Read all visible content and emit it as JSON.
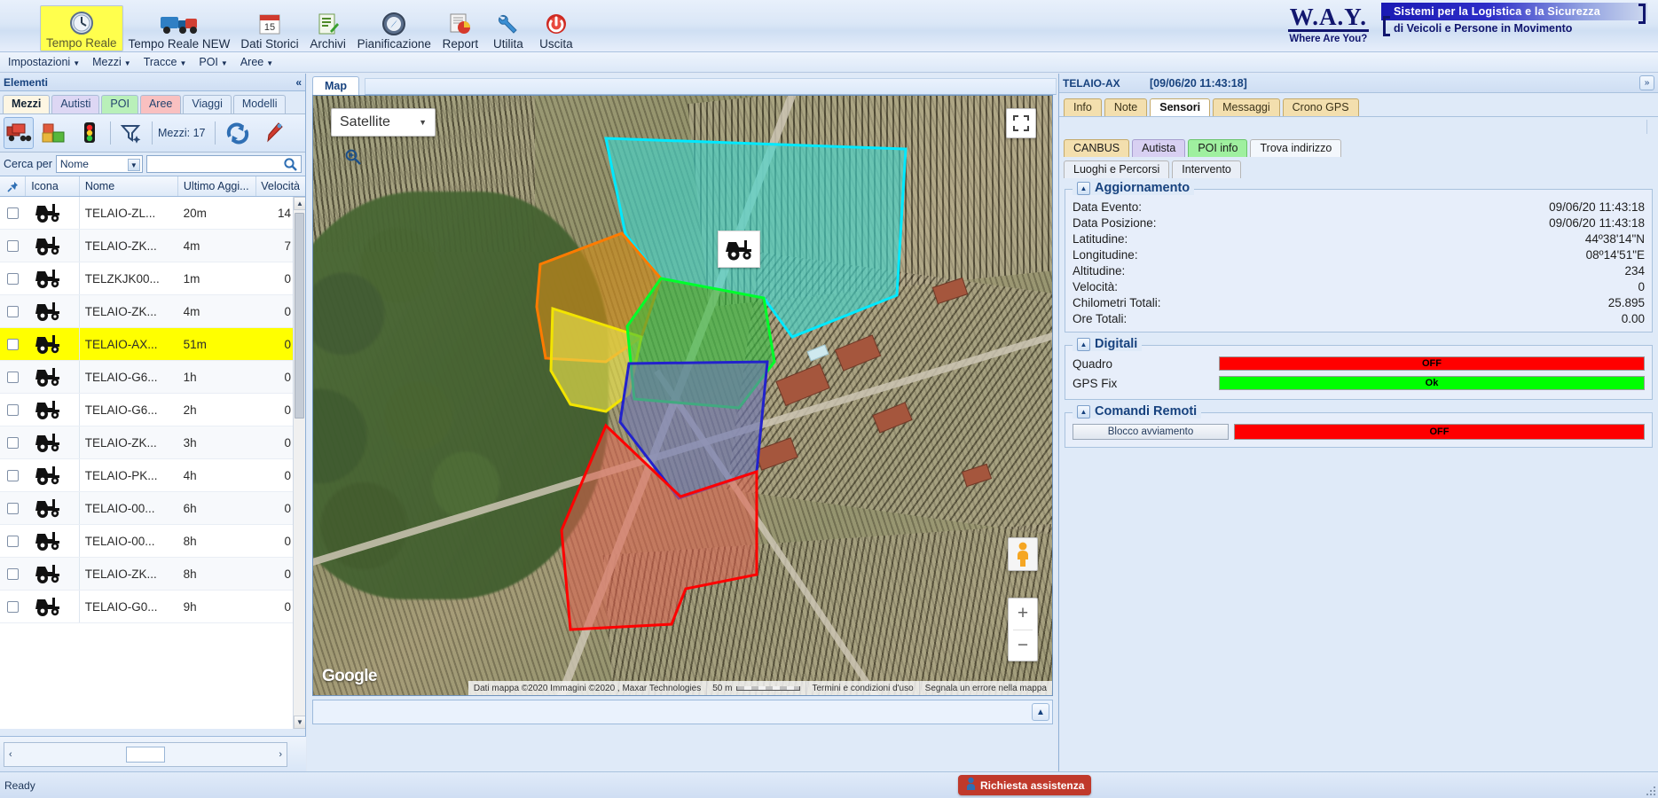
{
  "ribbon": {
    "items": [
      {
        "label": "Tempo Reale",
        "icon": "clock-icon",
        "active": true
      },
      {
        "label": "Tempo Reale NEW",
        "icon": "truck-icon",
        "active": false
      },
      {
        "label": "Dati Storici",
        "icon": "calendar-icon",
        "active": false
      },
      {
        "label": "Archivi",
        "icon": "document-edit-icon",
        "active": false
      },
      {
        "label": "Pianificazione",
        "icon": "compass-icon",
        "active": false
      },
      {
        "label": "Report",
        "icon": "report-chart-icon",
        "active": false
      },
      {
        "label": "Utilita",
        "icon": "wrench-icon",
        "active": false
      },
      {
        "label": "Uscita",
        "icon": "power-icon",
        "active": false
      }
    ],
    "logo": {
      "name": "W.A.Y.",
      "sub": "Where Are You?",
      "tagline_1": "Sistemi per la Logistica e la Sicurezza",
      "tagline_2": "di Veicoli e Persone in Movimento"
    }
  },
  "menubar": {
    "items": [
      "Impostazioni",
      "Mezzi",
      "Tracce",
      "POI",
      "Aree"
    ]
  },
  "left_panel": {
    "title": "Elementi",
    "collapse_icon": "chevron-double-left-icon",
    "tabs": [
      {
        "label": "Mezzi",
        "variant": "sel"
      },
      {
        "label": "Autisti",
        "variant": "v-autisti"
      },
      {
        "label": "POI",
        "variant": "v-poi"
      },
      {
        "label": "Aree",
        "variant": "v-aree"
      },
      {
        "label": "Viaggi",
        "variant": "v-plain"
      },
      {
        "label": "Modelli",
        "variant": "v-plain"
      }
    ],
    "toolbar": {
      "icons": [
        "fleet-icon",
        "packages-icon",
        "traffic-light-icon",
        "filter-icon",
        "refresh-icon",
        "marker-pin-icon"
      ],
      "count_label": "Mezzi: 17"
    },
    "search": {
      "label": "Cerca per",
      "select_value": "Nome",
      "input_value": "",
      "input_placeholder": "",
      "search_icon": "search-icon"
    },
    "grid": {
      "columns": [
        "",
        "Icona",
        "Nome",
        "Ultimo Aggi...",
        "Velocità"
      ],
      "rows": [
        {
          "name": "TELAIO-ZL...",
          "last": "20m",
          "speed": "14",
          "selected": false
        },
        {
          "name": "TELAIO-ZK...",
          "last": "4m",
          "speed": "7",
          "selected": false
        },
        {
          "name": "TELZKJK00...",
          "last": "1m",
          "speed": "0",
          "selected": false
        },
        {
          "name": "TELAIO-ZK...",
          "last": "4m",
          "speed": "0",
          "selected": false
        },
        {
          "name": "TELAIO-AX...",
          "last": "51m",
          "speed": "0",
          "selected": true
        },
        {
          "name": "TELAIO-G6...",
          "last": "1h",
          "speed": "0",
          "selected": false
        },
        {
          "name": "TELAIO-G6...",
          "last": "2h",
          "speed": "0",
          "selected": false
        },
        {
          "name": "TELAIO-ZK...",
          "last": "3h",
          "speed": "0",
          "selected": false
        },
        {
          "name": "TELAIO-PK...",
          "last": "4h",
          "speed": "0",
          "selected": false
        },
        {
          "name": "TELAIO-00...",
          "last": "6h",
          "speed": "0",
          "selected": false
        },
        {
          "name": "TELAIO-00...",
          "last": "8h",
          "speed": "0",
          "selected": false
        },
        {
          "name": "TELAIO-ZK...",
          "last": "8h",
          "speed": "0",
          "selected": false
        },
        {
          "name": "TELAIO-G0...",
          "last": "9h",
          "speed": "0",
          "selected": false
        }
      ]
    }
  },
  "map_panel": {
    "tab_label": "Map",
    "map_type": "Satellite",
    "map_type_caret": "chevron-down-icon",
    "controls": {
      "fullscreen_icon": "fullscreen-icon",
      "zoom_search_icon": "zoom-search-icon",
      "pegman_icon": "street-view-pegman-icon",
      "zoom_in": "+",
      "zoom_out": "−"
    },
    "watermark": "Google",
    "attribution": {
      "data": "Dati mappa ©2020 Immagini ©2020 , Maxar Technologies",
      "scale": "50 m",
      "terms": "Termini e condizioni d'uso",
      "report": "Segnala un errore nella mappa"
    },
    "vehicle_marker_icon": "tractor-icon",
    "zones": [
      {
        "name": "zone-cyan",
        "fill": "#3fd6cf",
        "stroke": "#00e5ff"
      },
      {
        "name": "zone-orange",
        "fill": "#d08a16",
        "stroke": "#ff7b00"
      },
      {
        "name": "zone-yellow",
        "fill": "#e8e04a",
        "stroke": "#f2e400"
      },
      {
        "name": "zone-green",
        "fill": "#2fbf3f",
        "stroke": "#00ff2a"
      },
      {
        "name": "zone-blue",
        "fill": "#6a74b5",
        "stroke": "#2222cc"
      },
      {
        "name": "zone-red",
        "fill": "#e0604f",
        "stroke": "#ff0000"
      }
    ]
  },
  "right_panel": {
    "vehicle": "TELAIO-AX",
    "datetime": "[09/06/20 11:43:18]",
    "expand_icon": "chevron-double-right-icon",
    "tabs": [
      {
        "label": "Info",
        "sel": false
      },
      {
        "label": "Note",
        "sel": false
      },
      {
        "label": "Sensori",
        "sel": true
      },
      {
        "label": "Messaggi",
        "sel": false
      },
      {
        "label": "Crono GPS",
        "sel": false
      }
    ],
    "tabs2": [
      {
        "label": "CANBUS",
        "variant": "canbus"
      },
      {
        "label": "Autista",
        "variant": "autista"
      },
      {
        "label": "POI info",
        "variant": "poiinfo"
      },
      {
        "label": "Trova indirizzo",
        "variant": "sel"
      }
    ],
    "tabs3": [
      {
        "label": "Luoghi e Percorsi"
      },
      {
        "label": "Intervento"
      }
    ],
    "aggiornamento": {
      "legend": "Aggiornamento",
      "toggle_icon": "collapse-up-icon",
      "fields": [
        {
          "key": "Data Evento:",
          "value": "09/06/20 11:43:18"
        },
        {
          "key": "Data Posizione:",
          "value": "09/06/20 11:43:18"
        },
        {
          "key": "Latitudine:",
          "value": "44º38'14\"N"
        },
        {
          "key": "Longitudine:",
          "value": "08º14'51\"E"
        },
        {
          "key": "Altitudine:",
          "value": "234"
        },
        {
          "key": "Velocità:",
          "value": "0"
        },
        {
          "key": "Chilometri Totali:",
          "value": "25.895"
        },
        {
          "key": "Ore Totali:",
          "value": "0.00"
        }
      ]
    },
    "digitali": {
      "legend": "Digitali",
      "toggle_icon": "collapse-up-icon",
      "rows": [
        {
          "key": "Quadro",
          "value": "OFF",
          "state": "red"
        },
        {
          "key": "GPS Fix",
          "value": "Ok",
          "state": "green"
        }
      ]
    },
    "comandi": {
      "legend": "Comandi Remoti",
      "toggle_icon": "collapse-up-icon",
      "rows": [
        {
          "button": "Blocco avviamento",
          "value": "OFF",
          "state": "red"
        }
      ]
    }
  },
  "statusbar": {
    "ready": "Ready",
    "assist_label": "Richiesta assistenza",
    "assist_icon": "support-icon",
    "assist_color": "#c0392b",
    "resize_icon": "resize-grip-icon"
  }
}
